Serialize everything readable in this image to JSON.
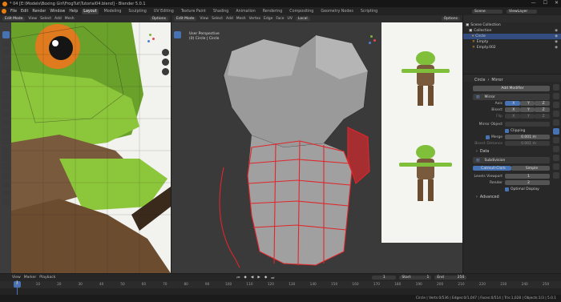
{
  "window": {
    "title": "* 04 [E:\\Models\\Boxing Girl\\FrogTut\\Tutorial04.blend] - Blender 5.0.1",
    "minimize": "—",
    "maximize": "☐",
    "close": "✕"
  },
  "menu": {
    "items": [
      "File",
      "Edit",
      "Render",
      "Window",
      "Help"
    ],
    "workspaces": [
      "Layout",
      "Modeling",
      "Sculpting",
      "UV Editing",
      "Texture Paint",
      "Shading",
      "Animation",
      "Rendering",
      "Compositing",
      "Geometry Nodes",
      "Scripting"
    ],
    "active_workspace": "Layout",
    "scene": "Scene",
    "view_layer": "ViewLayer"
  },
  "left_view": {
    "mode": "Edit Mode",
    "menus": [
      "View",
      "Select",
      "Add",
      "Mesh"
    ],
    "options": "Options"
  },
  "main_view": {
    "mode": "Edit Mode",
    "menus": [
      "View",
      "Select",
      "Add",
      "Mesh",
      "Vertex",
      "Edge",
      "Face",
      "UV"
    ],
    "transform": "Local",
    "options": "Options",
    "info_line1": "User Perspective",
    "info_line2": "(0) Circle | Circle"
  },
  "outliner": {
    "header": "Scene Collection",
    "items": [
      {
        "label": "Collection",
        "level": 1
      },
      {
        "label": "Circle",
        "level": 2,
        "selected": true
      },
      {
        "label": "Empty",
        "level": 2
      },
      {
        "label": "Empty.002",
        "level": 2
      }
    ]
  },
  "properties": {
    "breadcrumb_object": "Circle",
    "breadcrumb_modifier": "Mirror",
    "add_modifier": "Add Modifier",
    "mirror": {
      "name": "Mirror",
      "axis_label": "Axis",
      "bisect_label": "Bisect",
      "flip_label": "Flip",
      "axes": [
        "X",
        "Y",
        "Z"
      ],
      "mirror_object_label": "Mirror Object",
      "clipping_label": "Clipping",
      "merge_label": "Merge",
      "merge_value": "0.001 m",
      "bisect_distance_label": "Bisect Distance",
      "bisect_distance_value": "0.001 m",
      "data_label": "Data"
    },
    "subsurf": {
      "name": "Subdivision",
      "catmull": "Catmull-Clark",
      "simple": "Simple",
      "levels_viewport_label": "Levels Viewport",
      "levels_viewport": "1",
      "render_label": "Render",
      "render": "2",
      "optimal_label": "Optimal Display",
      "advanced_label": "Advanced"
    }
  },
  "timeline": {
    "menus": [
      "View",
      "Marker",
      "Playback"
    ],
    "current_frame": "1",
    "start_label": "Start",
    "start": "1",
    "end_label": "End",
    "end": "250",
    "ticks": [
      "0",
      "10",
      "20",
      "30",
      "40",
      "50",
      "60",
      "70",
      "80",
      "90",
      "100",
      "110",
      "120",
      "130",
      "140",
      "150",
      "160",
      "170",
      "180",
      "190",
      "200",
      "210",
      "220",
      "230",
      "240",
      "250"
    ]
  },
  "status": {
    "text": "Circle | Verts:0/536 | Edges:0/1,047 | Faces:0/514 | Tris:1,028 | Objects:1/3 | 5.0.1"
  },
  "colors": {
    "accent": "#4772b3",
    "edge": "#e0262b",
    "selected_row": "#334d80"
  }
}
